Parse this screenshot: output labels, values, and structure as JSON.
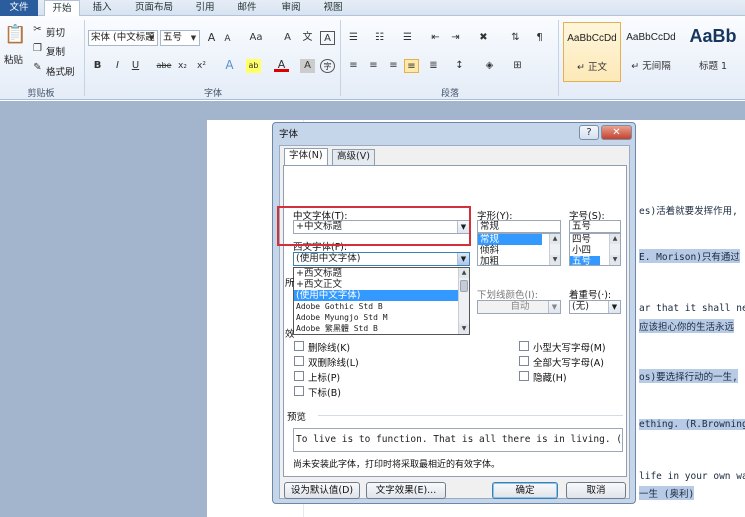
{
  "ribbon_tabs": [
    "文件",
    "开始",
    "插入",
    "页面布局",
    "引用",
    "邮件",
    "审阅",
    "视图"
  ],
  "clipboard": {
    "paste": "粘贴",
    "cut": "剪切",
    "copy": "复制",
    "format_painter": "格式刷",
    "group": "剪贴板"
  },
  "font_group": {
    "font": "宋体 (中文标题",
    "size": "五号",
    "grow": "A",
    "shrink": "A",
    "case": "Aa",
    "clear": "A",
    "phonetic": "文",
    "border_char": "A",
    "bold": "B",
    "italic": "I",
    "underline": "U",
    "strike": "abe",
    "sub": "x₂",
    "sup": "x²",
    "effects": "A",
    "highlight": "ab",
    "color": "A",
    "shade": "A",
    "circle": "字",
    "group": "字体"
  },
  "paragraph_group": {
    "group": "段落"
  },
  "styles": [
    {
      "sample": "AaBbCcDd",
      "name": "↵ 正文"
    },
    {
      "sample": "AaBbCcDd",
      "name": "↵ 无间隔"
    },
    {
      "sample": "AaBb",
      "name": "标题 1"
    }
  ],
  "document_lines": [
    "es)活着就要发挥作用,",
    "E. Morison)只有通过",
    "ar that it shall neve",
    "应该担心你的生活永远",
    "os)要选择行动的一生,",
    "ething. (R.Browning",
    "life in your own wa",
    "一生 (奥利)"
  ],
  "dialog": {
    "title": "字体",
    "help": "?",
    "close": "✕",
    "tabs": [
      "字体(N)",
      "高级(V)"
    ],
    "cn_font_label": "中文字体(T):",
    "cn_font_value": "+中文标题",
    "style_label": "字形(Y):",
    "style_value": "常规",
    "style_options": [
      "常规",
      "倾斜",
      "加粗"
    ],
    "size_label": "字号(S):",
    "size_value": "五号",
    "size_options": [
      "四号",
      "小四",
      "五号"
    ],
    "west_font_label": "西文字体(F):",
    "west_font_value": "(使用中文字体)",
    "west_font_options": [
      "+西文标题",
      "+西文正文",
      "(使用中文字体)",
      "Adobe Gothic Std B",
      "Adobe Myungjo Std M",
      "Adobe 繁黑體 Std B"
    ],
    "all_text_label": "所",
    "underline_color_label": "下划线颜色(I):",
    "underline_color_value": "自动",
    "emphasis_label": "着重号(·):",
    "emphasis_value": "(无)",
    "effects_label": "效",
    "effects_left": [
      "删除线(K)",
      "双删除线(L)",
      "上标(P)",
      "下标(B)"
    ],
    "effects_right": [
      "小型大写字母(M)",
      "全部大写字母(A)",
      "隐藏(H)"
    ],
    "preview_label": "预览",
    "preview_text": "To live is to function. That is all there is in living. (H",
    "preview_note": "尚未安装此字体，打印时将采取最相近的有效字体。",
    "set_default": "设为默认值(D)",
    "text_effects": "文字效果(E)...",
    "ok": "确定",
    "cancel": "取消"
  }
}
